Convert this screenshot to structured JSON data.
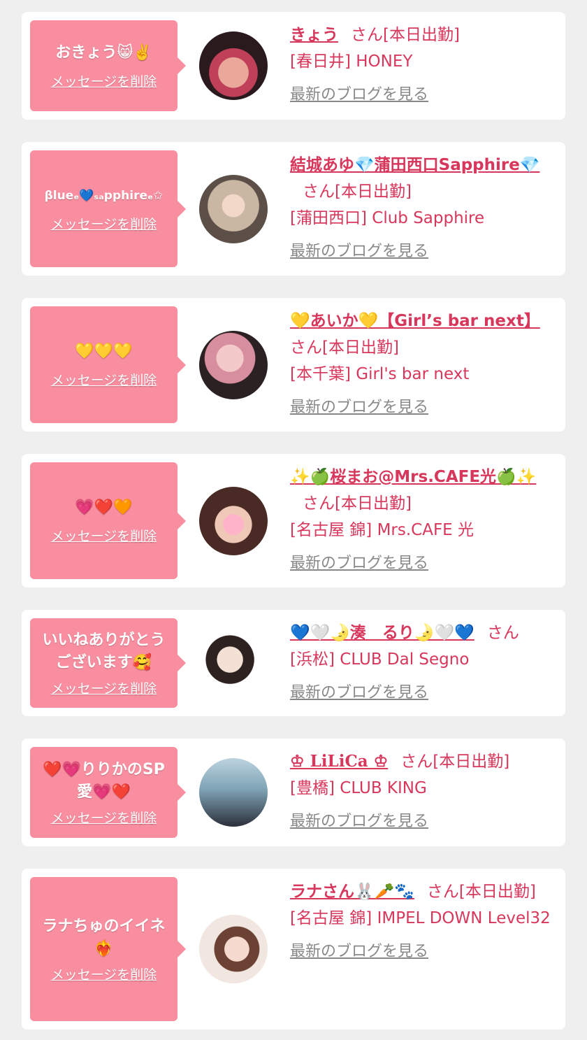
{
  "colors": {
    "bubble": "#f98ea0",
    "accent": "#d8375c",
    "link_gray": "#888888",
    "background": "#efefef"
  },
  "delete_label": "メッセージを削除",
  "blog_label": "最新のブログを見る",
  "cards": [
    {
      "message": "おきょう😸✌️",
      "name": "きょう",
      "san": "さん[本日出勤]",
      "shop": "[春日井] HONEY",
      "avatar_icon": "person-photo"
    },
    {
      "message": "βlueₑ💙ₛₐpphireₑ✩",
      "name": "結城あゆ💎蒲田西口Sapphire💎",
      "san": "さん[本日出勤]",
      "shop": "[蒲田西口] Club Sapphire",
      "avatar_icon": "person-photo"
    },
    {
      "message": "💛💛💛",
      "name": "💛あいか💛【Girl’s bar next】",
      "san": "さん[本日出勤]",
      "shop": "[本千葉] Girl's bar next",
      "avatar_icon": "person-photo"
    },
    {
      "message": "💗❤️🧡",
      "name": "✨🍏桜まお@Mrs.CAFE光🍏✨",
      "san": "さん[本日出勤]",
      "shop": "[名古屋 錦] Mrs.CAFE 光",
      "avatar_icon": "person-photo"
    },
    {
      "message": "いいねありがとうございます🥰",
      "name": "💙🤍🌛湊　るり🌛🤍💙",
      "san": "さん",
      "shop": "[浜松] CLUB Dal Segno",
      "avatar_icon": "person-photo"
    },
    {
      "message": "❤️💗りりかのSP愛💗❤️",
      "name": "♔ LiLiCa ♔",
      "san": "さん[本日出勤]",
      "shop": "[豊橋] CLUB KING",
      "avatar_icon": "person-photo"
    },
    {
      "message": "ラナちゅのイイネ❤️‍🔥",
      "name": "ラナさん🐰🥕🐾",
      "san": "さん[本日出勤]",
      "shop": "[名古屋 錦] IMPEL DOWN Level32",
      "avatar_icon": "person-photo"
    }
  ]
}
